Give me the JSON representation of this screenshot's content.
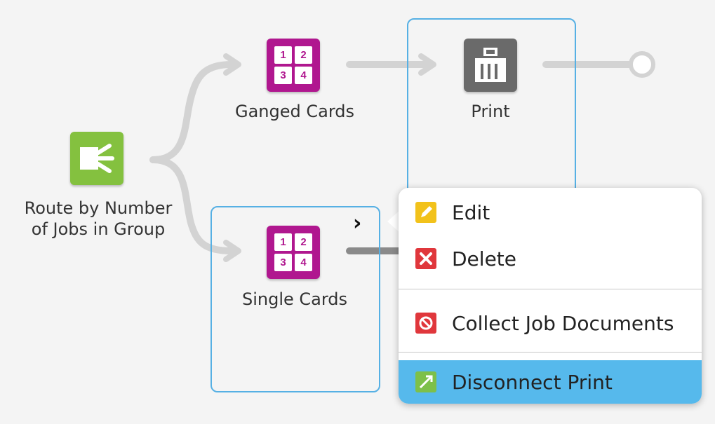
{
  "workflow": {
    "nodes": [
      {
        "id": "route",
        "label_line1": "Route by Number",
        "label_line2": "of Jobs in Group",
        "icon": "split-route-icon",
        "color": "#84c13f"
      },
      {
        "id": "ganged",
        "label": "Ganged Cards",
        "icon": "card-grid-icon",
        "color": "#b0178f",
        "grid": [
          "1",
          "2",
          "3",
          "4"
        ]
      },
      {
        "id": "print",
        "label": "Print",
        "icon": "printer-icon",
        "color": "#6a6a6a"
      },
      {
        "id": "single",
        "label": "Single Cards",
        "icon": "card-grid-icon",
        "color": "#b0178f",
        "grid": [
          "1",
          "2",
          "3",
          "4"
        ]
      }
    ],
    "selection_color": "#56b0e4",
    "connector_color": "#d3d3d3"
  },
  "context_menu": {
    "items": [
      {
        "label": "Edit",
        "icon": "pencil-icon",
        "icon_color": "#f2c21b"
      },
      {
        "label": "Delete",
        "icon": "delete-x-icon",
        "icon_color": "#e0373c"
      },
      {
        "label": "Collect Job Documents",
        "icon": "collect-stop-icon",
        "icon_color": "#e0373c"
      },
      {
        "label": "Disconnect Print",
        "icon": "disconnect-icon",
        "icon_color": "#7dc04a",
        "highlighted": true
      }
    ],
    "highlight_color": "#56b9ec"
  }
}
